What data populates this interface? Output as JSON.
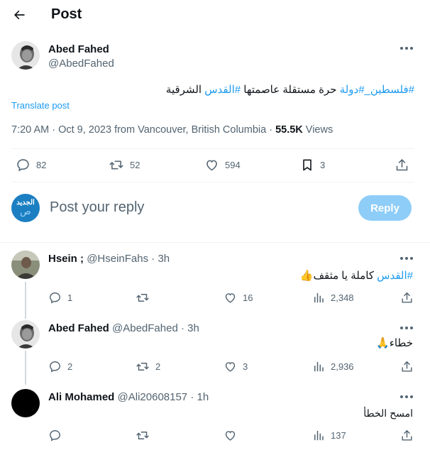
{
  "header": {
    "title": "Post",
    "back_icon": "back-arrow-icon"
  },
  "main_post": {
    "author_name": "Abed Fahed",
    "author_handle": "@AbedFahed",
    "text_hash1": "#فلسطين_",
    "text_hash2": "#دولة",
    "text_plain1": " حرة مستقلة عاصمتها ",
    "text_hash3": "#القدس",
    "text_plain2": " الشرقية",
    "translate_label": "Translate post",
    "meta_time": "7:20 AM · Oct 9, 2023 from Vancouver, British Columbia · ",
    "meta_views_count": "55.5K",
    "meta_views_label": " Views",
    "stats": {
      "replies": "82",
      "reposts": "52",
      "likes": "594",
      "bookmarks": "3"
    }
  },
  "reply_box": {
    "avatar_text_top": "الجديد",
    "avatar_text_bottom": "ص",
    "placeholder": "Post your reply",
    "button_label": "Reply"
  },
  "replies": [
    {
      "author_name": "Hsein ;",
      "author_handle": "@HseinFahs",
      "time": "3h",
      "text_hash": "#القدس",
      "text_plain": " كاملة يا مثقف",
      "emoji": "👍",
      "stats": {
        "replies": "1",
        "reposts": "",
        "likes": "16",
        "views": "2,348"
      }
    },
    {
      "author_name": "Abed Fahed",
      "author_handle": "@AbedFahed",
      "time": "3h",
      "text_plain": "خطاء",
      "emoji": "🙏",
      "stats": {
        "replies": "2",
        "reposts": "2",
        "likes": "3",
        "views": "2,936"
      }
    },
    {
      "author_name": "Ali Mohamed",
      "author_handle": "@Ali20608157",
      "time": "1h",
      "text_plain": "امسح الخطأ",
      "stats": {
        "replies": "",
        "reposts": "",
        "likes": "",
        "views": "137"
      }
    }
  ],
  "separator": " · ",
  "colors": {
    "accent": "#1d9bf0",
    "reply_button_bg": "#8ecdf8",
    "muted_text": "#536471",
    "divider": "#eff3f4"
  }
}
